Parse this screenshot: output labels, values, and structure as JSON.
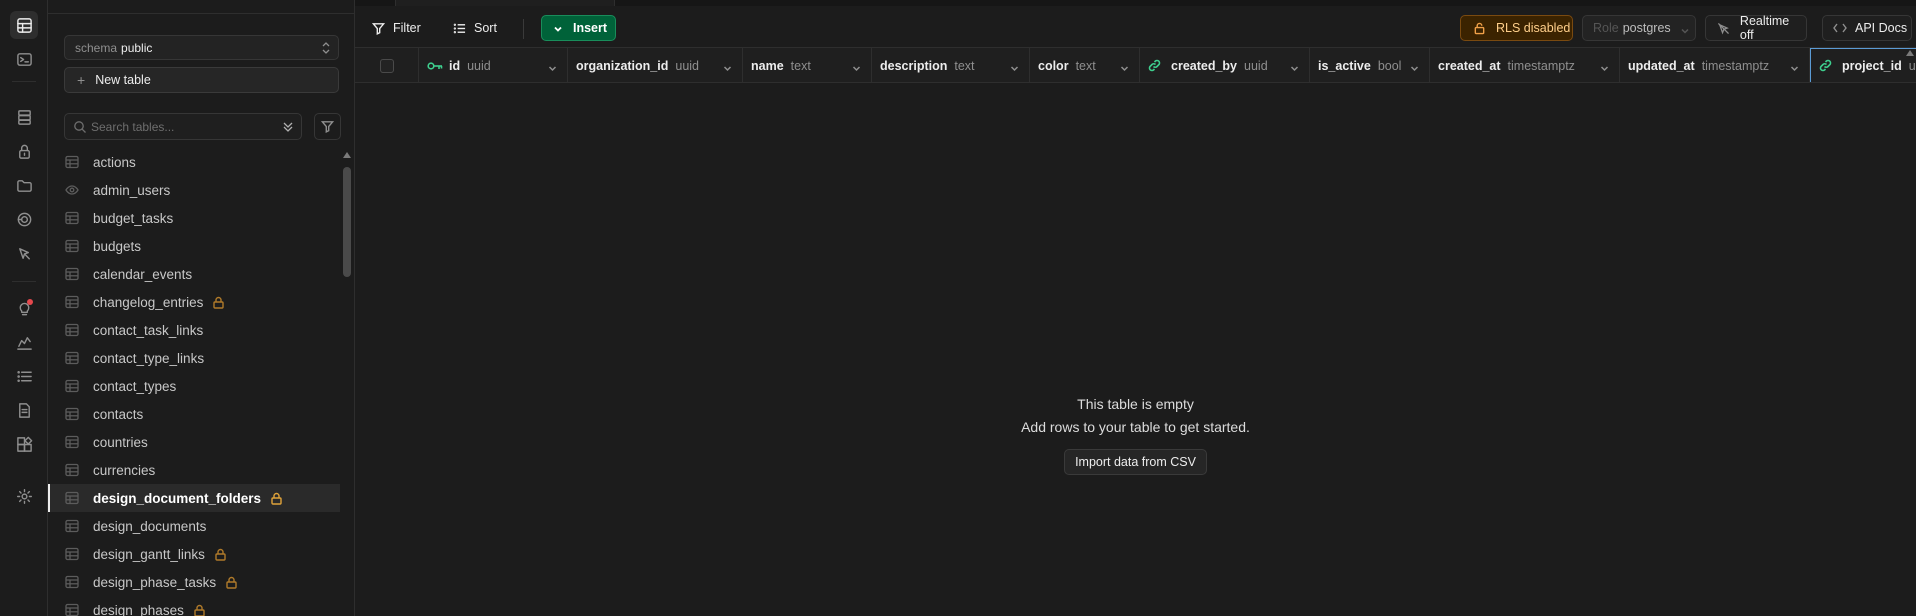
{
  "sidebar": {
    "schema_label": "schema",
    "schema_value": "public",
    "new_table_label": "New table",
    "search_placeholder": "Search tables...",
    "tables": [
      {
        "name": "actions",
        "icon": "table-icon",
        "locked": false
      },
      {
        "name": "admin_users",
        "icon": "view-icon",
        "locked": false
      },
      {
        "name": "budget_tasks",
        "icon": "table-icon",
        "locked": false
      },
      {
        "name": "budgets",
        "icon": "table-icon",
        "locked": false
      },
      {
        "name": "calendar_events",
        "icon": "table-icon",
        "locked": false
      },
      {
        "name": "changelog_entries",
        "icon": "table-icon",
        "locked": true
      },
      {
        "name": "contact_task_links",
        "icon": "table-icon",
        "locked": false
      },
      {
        "name": "contact_type_links",
        "icon": "table-icon",
        "locked": false
      },
      {
        "name": "contact_types",
        "icon": "table-icon",
        "locked": false
      },
      {
        "name": "contacts",
        "icon": "table-icon",
        "locked": false
      },
      {
        "name": "countries",
        "icon": "table-icon",
        "locked": false
      },
      {
        "name": "currencies",
        "icon": "table-icon",
        "locked": false
      },
      {
        "name": "design_document_folders",
        "icon": "table-icon",
        "locked": true,
        "selected": true
      },
      {
        "name": "design_documents",
        "icon": "table-icon",
        "locked": false
      },
      {
        "name": "design_gantt_links",
        "icon": "table-icon",
        "locked": true
      },
      {
        "name": "design_phase_tasks",
        "icon": "table-icon",
        "locked": true
      },
      {
        "name": "design_phases",
        "icon": "table-icon",
        "locked": true
      }
    ]
  },
  "toolbar": {
    "filter_label": "Filter",
    "sort_label": "Sort",
    "insert_label": "Insert",
    "rls_label": "RLS disabled",
    "role_label": "Role",
    "role_value": "postgres",
    "realtime_label": "Realtime off",
    "api_docs_label": "API Docs"
  },
  "columns": [
    {
      "name": "id",
      "type": "uuid",
      "key": true
    },
    {
      "name": "organization_id",
      "type": "uuid",
      "link": true
    },
    {
      "name": "name",
      "type": "text"
    },
    {
      "name": "description",
      "type": "text"
    },
    {
      "name": "color",
      "type": "text"
    },
    {
      "name": "created_by",
      "type": "uuid",
      "link": true
    },
    {
      "name": "is_active",
      "type": "bool"
    },
    {
      "name": "created_at",
      "type": "timestamptz"
    },
    {
      "name": "updated_at",
      "type": "timestamptz"
    },
    {
      "name": "project_id",
      "type": "uuid",
      "link": true
    }
  ],
  "empty_state": {
    "title": "This table is empty",
    "subtitle": "Add rows to your table to get started.",
    "import_label": "Import data from CSV"
  },
  "colors": {
    "accent_green": "#3ecf8e",
    "insert_bg": "#006239",
    "rls_warning": "#f0a048",
    "lock": "#e0a33a"
  }
}
